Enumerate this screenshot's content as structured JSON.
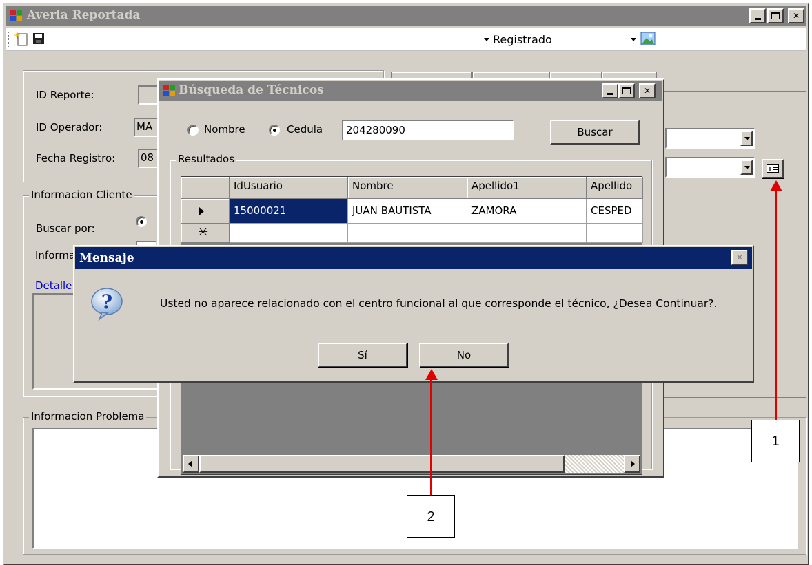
{
  "main_window": {
    "title": "Averia Reportada",
    "status_value": "Registrado",
    "id_reporte_label": "ID Reporte:",
    "id_operador_label": "ID Operador:",
    "id_operador_value": "MA",
    "fecha_registro_label": "Fecha Registro:",
    "fecha_registro_value": "08",
    "cliente_group_label": "Informacion Cliente",
    "buscar_por_label": "Buscar por:",
    "informacion_label": "Informa",
    "detalle_link": "Detalle",
    "problema_group_label": "Informacion Problema"
  },
  "search_dialog": {
    "title": "Búsqueda de Técnicos",
    "radio_nombre_label": "Nombre",
    "radio_cedula_label": "Cedula",
    "search_value": "204280090",
    "buscar_button": "Buscar",
    "resultados_label": "Resultados",
    "columns": [
      "IdUsuario",
      "Nombre",
      "Apellido1",
      "Apellido"
    ],
    "rows": [
      [
        "15000021",
        "JUAN BAUTISTA",
        "ZAMORA",
        "CESPED"
      ]
    ]
  },
  "message_box": {
    "title": "Mensaje",
    "message": "Usted no aparece relacionado con el centro funcional al que corresponde el técnico, ¿Desea Continuar?.",
    "yes_button": "Sí",
    "no_button": "No"
  },
  "callouts": {
    "one": "1",
    "two": "2"
  },
  "colors": {
    "title_active": "#0a246a",
    "title_inactive": "#808080",
    "face": "#d4d0c8",
    "selection": "#0a246a",
    "callout": "#e00000"
  }
}
